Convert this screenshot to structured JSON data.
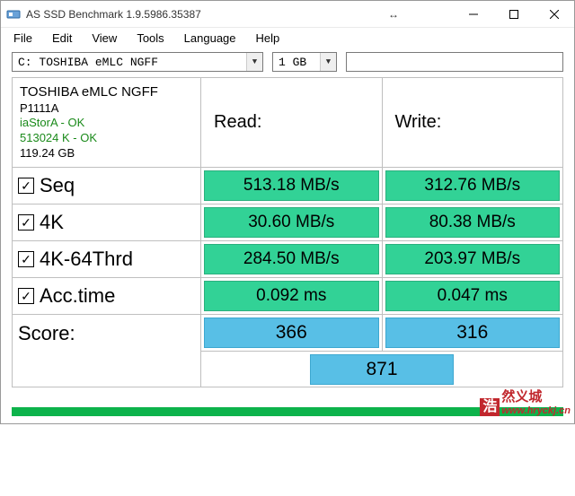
{
  "window": {
    "title": "AS SSD Benchmark 1.9.5986.35387"
  },
  "menu": {
    "file": "File",
    "edit": "Edit",
    "view": "View",
    "tools": "Tools",
    "language": "Language",
    "help": "Help"
  },
  "selectors": {
    "drive": "C: TOSHIBA eMLC NGFF",
    "size": "1 GB"
  },
  "device": {
    "name": "TOSHIBA eMLC NGFF",
    "firmware": "P1111A",
    "driver_status": "iaStorA - OK",
    "alignment_status": "513024 K - OK",
    "capacity": "119.24 GB"
  },
  "headers": {
    "read": "Read:",
    "write": "Write:"
  },
  "tests": {
    "seq": {
      "label": "Seq",
      "read": "513.18 MB/s",
      "write": "312.76 MB/s"
    },
    "fourk": {
      "label": "4K",
      "read": "30.60 MB/s",
      "write": "80.38 MB/s"
    },
    "fourk64": {
      "label": "4K-64Thrd",
      "read": "284.50 MB/s",
      "write": "203.97 MB/s"
    },
    "acc": {
      "label": "Acc.time",
      "read": "0.092 ms",
      "write": "0.047 ms"
    }
  },
  "score": {
    "label": "Score:",
    "read": "366",
    "write": "316",
    "total": "871"
  },
  "watermark": {
    "badge_line1": "浩",
    "badge_line2": "然义城",
    "url": "www.hryckj.cn"
  }
}
